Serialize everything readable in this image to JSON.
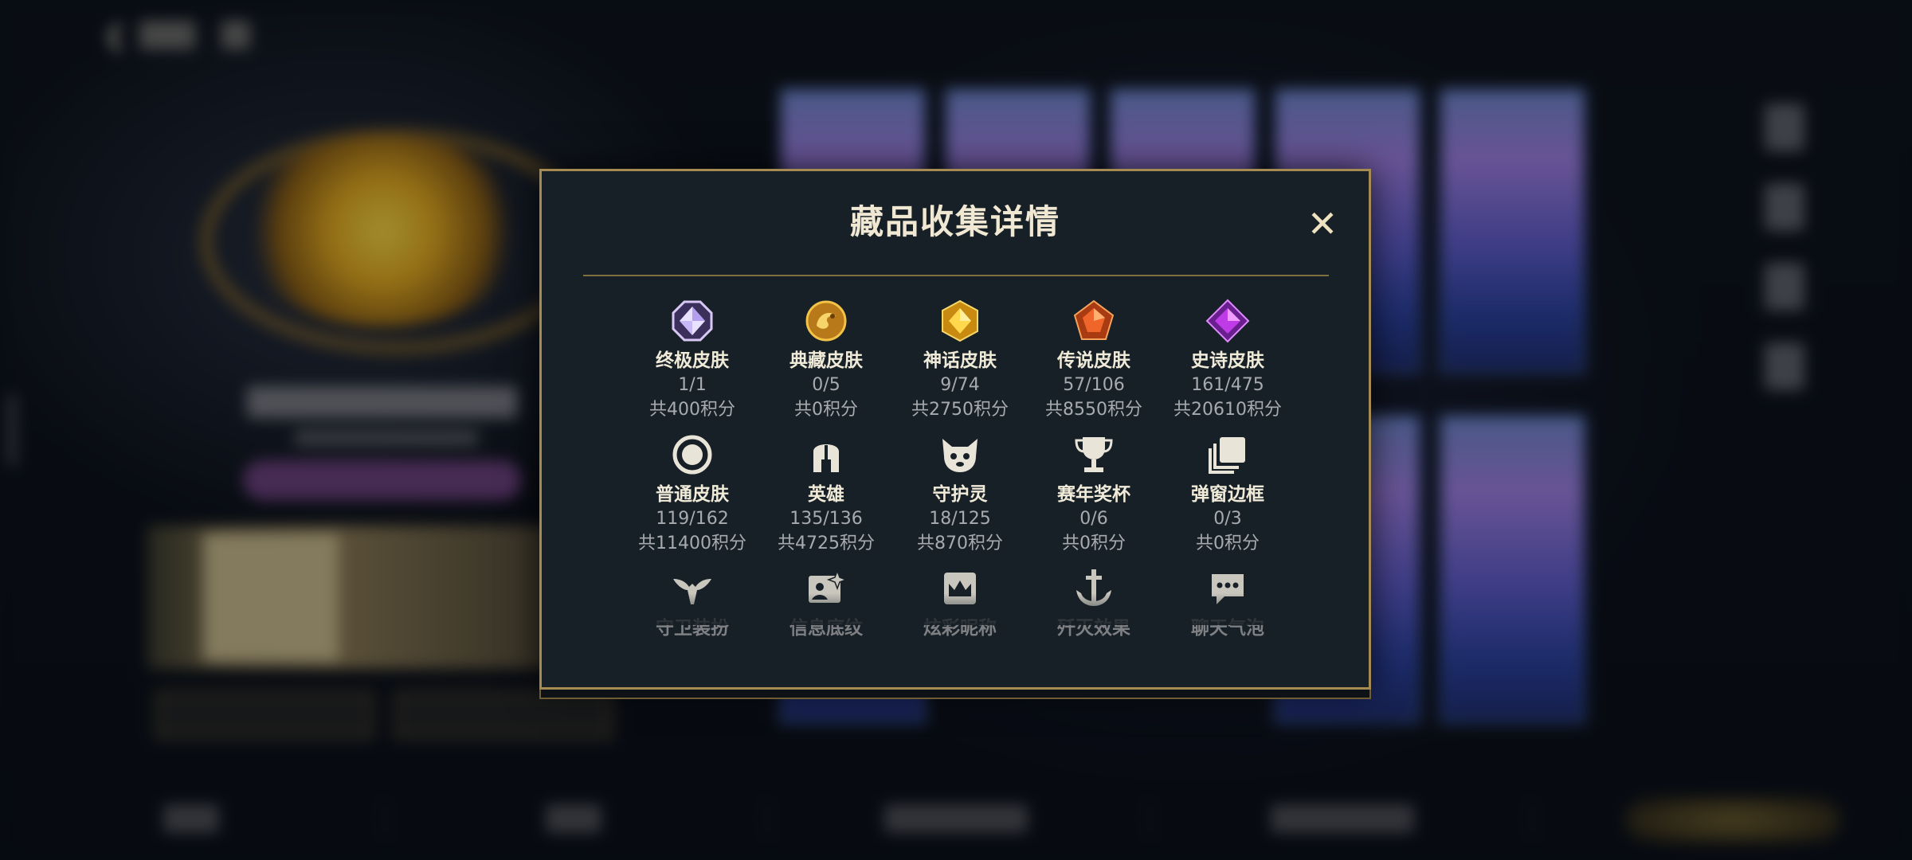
{
  "modal": {
    "title": "藏品收集详情",
    "close_symbol": "✕",
    "rows": [
      [
        {
          "icon": "crystal-octagon-icon",
          "name": "终极皮肤",
          "count": "1/1",
          "points": "共400积分"
        },
        {
          "icon": "dragon-medal-icon",
          "name": "典藏皮肤",
          "count": "0/5",
          "points": "共0积分"
        },
        {
          "icon": "gold-hexagon-gem-icon",
          "name": "神话皮肤",
          "count": "9/74",
          "points": "共2750积分"
        },
        {
          "icon": "orange-pentagon-gem-icon",
          "name": "传说皮肤",
          "count": "57/106",
          "points": "共8550积分"
        },
        {
          "icon": "purple-diamond-gem-icon",
          "name": "史诗皮肤",
          "count": "161/475",
          "points": "共20610积分"
        }
      ],
      [
        {
          "icon": "ring-circle-icon",
          "name": "普通皮肤",
          "count": "119/162",
          "points": "共11400积分"
        },
        {
          "icon": "helmet-icon",
          "name": "英雄",
          "count": "135/136",
          "points": "共4725积分"
        },
        {
          "icon": "guardian-pet-icon",
          "name": "守护灵",
          "count": "18/125",
          "points": "共870积分"
        },
        {
          "icon": "trophy-icon",
          "name": "赛年奖杯",
          "count": "0/6",
          "points": "共0积分"
        },
        {
          "icon": "stacked-frames-icon",
          "name": "弹窗边框",
          "count": "0/3",
          "points": "共0积分"
        }
      ],
      [
        {
          "icon": "winged-guard-icon",
          "name": "守卫装扮"
        },
        {
          "icon": "sparkle-card-icon",
          "name": "信息底纹"
        },
        {
          "icon": "crown-badge-icon",
          "name": "炫彩昵称"
        },
        {
          "icon": "anchor-sword-icon",
          "name": "歼灭效果"
        },
        {
          "icon": "chat-bubble-icon",
          "name": "聊天气泡"
        }
      ]
    ]
  },
  "colors": {
    "modal_bg": "#182027",
    "modal_border": "#a58b52",
    "accent_gold": "#d8a531",
    "text_primary": "#f0ead8",
    "text_secondary": "#a7abb0"
  }
}
